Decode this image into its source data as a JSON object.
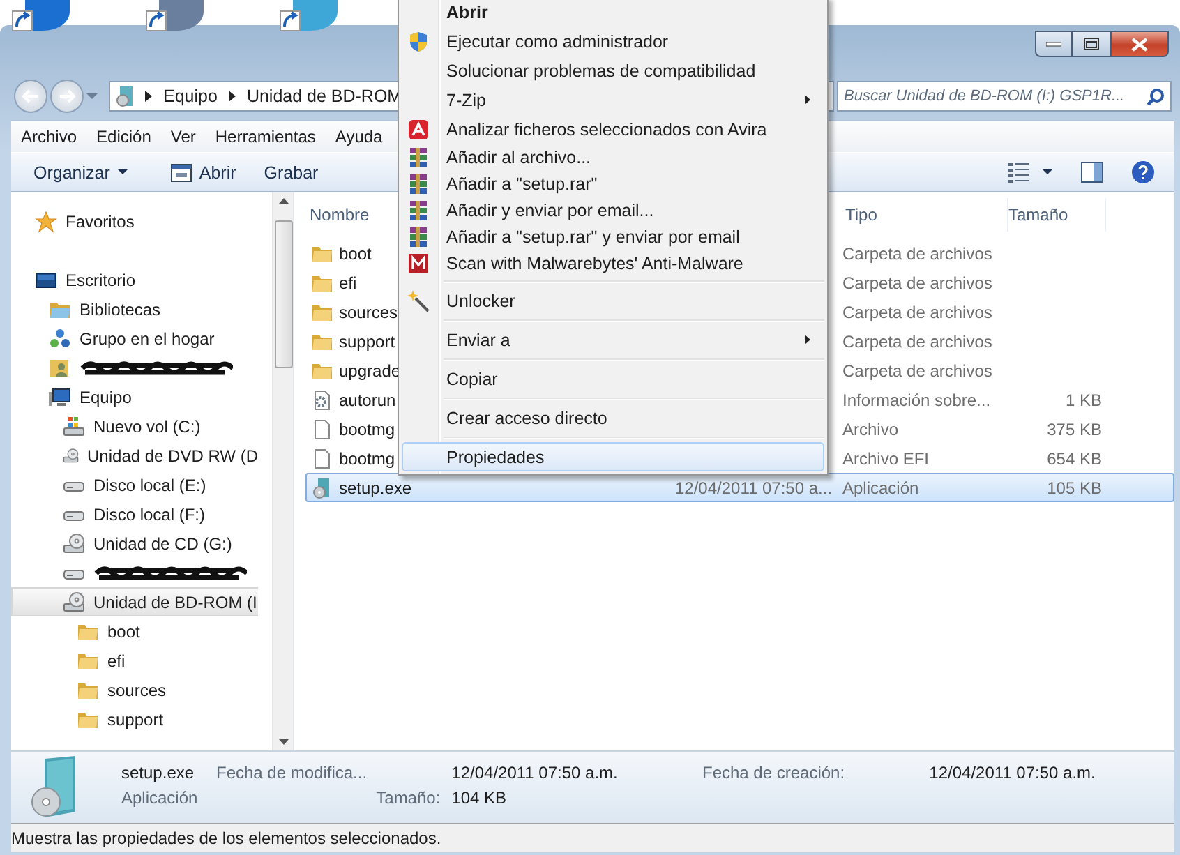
{
  "address_bar": {
    "crumbs": [
      "Equipo",
      "Unidad de BD-ROM"
    ]
  },
  "search": {
    "placeholder": "Buscar Unidad de BD-ROM (I:) GSP1R..."
  },
  "menu_bar": [
    "Archivo",
    "Edición",
    "Ver",
    "Herramientas",
    "Ayuda"
  ],
  "command_bar": [
    {
      "label": "Organizar",
      "kind": "dropdown"
    },
    {
      "label": "Abrir",
      "kind": "open"
    },
    {
      "label": "Grabar",
      "kind": "plain"
    }
  ],
  "nav_pane": {
    "items": [
      {
        "label": "Favoritos",
        "kind": "star",
        "selected": false
      },
      {
        "label": "Escritorio",
        "kind": "desktop",
        "selected": false,
        "children": [
          {
            "label": "Bibliotecas",
            "kind": "library",
            "selected": false
          },
          {
            "label": "Grupo en el hogar",
            "kind": "homegroup",
            "selected": false
          },
          {
            "kind": "user",
            "selected": false
          },
          {
            "label": "Equipo",
            "kind": "computer",
            "selected": false,
            "children": [
              {
                "label": "Nuevo vol (C:)",
                "kind": "system-drive",
                "selected": false
              },
              {
                "label": "Unidad de DVD RW (D",
                "kind": "optical",
                "selected": false
              },
              {
                "label": "Disco local (E:)",
                "kind": "disk",
                "selected": false
              },
              {
                "label": "Disco local (F:)",
                "kind": "disk",
                "selected": false
              },
              {
                "label": "Unidad de CD (G:)",
                "kind": "optical",
                "selected": false
              },
              {
                "kind": "disk",
                "selected": false
              },
              {
                "label": "Unidad de BD-ROM (I",
                "kind": "optical",
                "selected": true,
                "children": [
                  {
                    "label": "boot",
                    "kind": "folder",
                    "selected": false
                  },
                  {
                    "label": "efi",
                    "kind": "folder",
                    "selected": false
                  },
                  {
                    "label": "sources",
                    "kind": "folder",
                    "selected": false
                  },
                  {
                    "label": "support",
                    "kind": "folder",
                    "selected": false
                  }
                ]
              }
            ]
          }
        ]
      }
    ]
  },
  "file_list": {
    "columns": [
      {
        "label": "Nombre",
        "kind": "name"
      },
      {
        "label": "Tipo",
        "kind": "type"
      },
      {
        "label": "Tamaño",
        "kind": "size"
      }
    ],
    "rows": [
      {
        "name": "boot",
        "kind": "folder",
        "type": "Carpeta de archivos",
        "selected": false
      },
      {
        "name": "efi",
        "kind": "folder",
        "type": "Carpeta de archivos",
        "selected": false
      },
      {
        "name": "sources",
        "kind": "folder",
        "type": "Carpeta de archivos",
        "selected": false
      },
      {
        "name": "support",
        "kind": "folder",
        "type": "Carpeta de archivos",
        "selected": false
      },
      {
        "name": "upgrade",
        "kind": "folder",
        "type": "Carpeta de archivos",
        "selected": false
      },
      {
        "name": "autorun",
        "kind": "settings",
        "type": "Información sobre...",
        "size": "1 KB",
        "selected": false
      },
      {
        "name": "bootmg",
        "kind": "file",
        "type": "Archivo",
        "size": "375 KB",
        "selected": false
      },
      {
        "name": "bootmg",
        "kind": "file",
        "type": "Archivo EFI",
        "size": "654 KB",
        "selected": false
      },
      {
        "name": "setup.exe",
        "kind": "app",
        "date": "12/04/2011 07:50 a...",
        "type": "Aplicación",
        "size": "105 KB",
        "selected": true
      }
    ]
  },
  "context_menu": {
    "items": [
      {
        "label": "Abrir",
        "kind": "none",
        "default": true,
        "submenu": false,
        "selected": false
      },
      {
        "label": "Ejecutar como administrador",
        "kind": "shield",
        "default": false,
        "submenu": false,
        "selected": false
      },
      {
        "label": "Solucionar problemas de compatibilidad",
        "kind": "none",
        "default": false,
        "submenu": false,
        "selected": false
      },
      {
        "label": "7-Zip",
        "kind": "none",
        "default": false,
        "submenu": true,
        "selected": false
      },
      {
        "label": "Analizar ficheros seleccionados con Avira",
        "kind": "antivirus",
        "default": false,
        "submenu": false,
        "selected": false
      },
      {
        "label": "Añadir al archivo...",
        "kind": "archive",
        "default": false,
        "submenu": false,
        "selected": false
      },
      {
        "label": "Añadir a \"setup.rar\"",
        "kind": "archive",
        "default": false,
        "submenu": false,
        "selected": false
      },
      {
        "label": "Añadir y enviar por email...",
        "kind": "archive",
        "default": false,
        "submenu": false,
        "selected": false
      },
      {
        "label": "Añadir a \"setup.rar\" y enviar por email",
        "kind": "archive",
        "default": false,
        "submenu": false,
        "selected": false
      },
      {
        "label": "Scan with Malwarebytes' Anti-Malware",
        "kind": "scanner",
        "default": false,
        "submenu": false,
        "selected": false
      },
      {
        "kind": "separator"
      },
      {
        "label": "Unlocker",
        "kind": "wand",
        "default": false,
        "submenu": false,
        "selected": false
      },
      {
        "kind": "separator"
      },
      {
        "label": "Enviar a",
        "kind": "none",
        "default": false,
        "submenu": true,
        "selected": false
      },
      {
        "kind": "separator"
      },
      {
        "label": "Copiar",
        "kind": "none",
        "default": false,
        "submenu": false,
        "selected": false
      },
      {
        "kind": "separator"
      },
      {
        "label": "Crear acceso directo",
        "kind": "none",
        "default": false,
        "submenu": false,
        "selected": false
      },
      {
        "kind": "separator"
      },
      {
        "label": "Propiedades",
        "kind": "none",
        "default": false,
        "submenu": false,
        "selected": true
      }
    ]
  },
  "details_pane": {
    "name": "setup.exe",
    "type": "Aplicación",
    "fields": [
      {
        "label": "Fecha de modifica...",
        "value": "12/04/2011 07:50 a.m."
      },
      {
        "label": "Tamaño:",
        "value": "104 KB"
      },
      {
        "label": "Fecha de creación:",
        "value": "12/04/2011 07:50 a.m."
      }
    ]
  },
  "status_bar": "Muestra las propiedades de los elementos seleccionados."
}
